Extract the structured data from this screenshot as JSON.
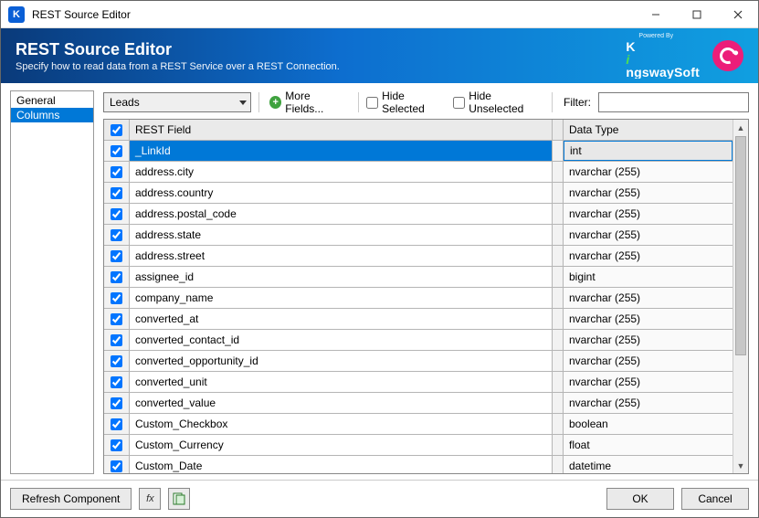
{
  "window": {
    "title": "REST Source Editor"
  },
  "banner": {
    "title": "REST Source Editor",
    "subtitle": "Specify how to read data from a REST Service over a REST Connection.",
    "poweredBy": "Powered By",
    "brand": "KingswaySoft"
  },
  "sidebar": {
    "items": [
      {
        "label": "General",
        "selected": false
      },
      {
        "label": "Columns",
        "selected": true
      }
    ]
  },
  "toolbar": {
    "combo_value": "Leads",
    "more_fields_label": "More Fields...",
    "hide_selected_label": "Hide Selected",
    "hide_unselected_label": "Hide Unselected",
    "hide_selected_checked": false,
    "hide_unselected_checked": false,
    "filter_label": "Filter:",
    "filter_value": ""
  },
  "grid": {
    "header": {
      "field": "REST Field",
      "type": "Data Type"
    },
    "rows": [
      {
        "checked": true,
        "field": "_LinkId",
        "type": "int",
        "selected": true
      },
      {
        "checked": true,
        "field": "address.city",
        "type": "nvarchar (255)"
      },
      {
        "checked": true,
        "field": "address.country",
        "type": "nvarchar (255)"
      },
      {
        "checked": true,
        "field": "address.postal_code",
        "type": "nvarchar (255)"
      },
      {
        "checked": true,
        "field": "address.state",
        "type": "nvarchar (255)"
      },
      {
        "checked": true,
        "field": "address.street",
        "type": "nvarchar (255)"
      },
      {
        "checked": true,
        "field": "assignee_id",
        "type": "bigint"
      },
      {
        "checked": true,
        "field": "company_name",
        "type": "nvarchar (255)"
      },
      {
        "checked": true,
        "field": "converted_at",
        "type": "nvarchar (255)"
      },
      {
        "checked": true,
        "field": "converted_contact_id",
        "type": "nvarchar (255)"
      },
      {
        "checked": true,
        "field": "converted_opportunity_id",
        "type": "nvarchar (255)"
      },
      {
        "checked": true,
        "field": "converted_unit",
        "type": "nvarchar (255)"
      },
      {
        "checked": true,
        "field": "converted_value",
        "type": "nvarchar (255)"
      },
      {
        "checked": true,
        "field": "Custom_Checkbox",
        "type": "boolean"
      },
      {
        "checked": true,
        "field": "Custom_Currency",
        "type": "float"
      },
      {
        "checked": true,
        "field": "Custom_Date",
        "type": "datetime"
      }
    ]
  },
  "footer": {
    "refresh_label": "Refresh Component",
    "ok_label": "OK",
    "cancel_label": "Cancel"
  }
}
